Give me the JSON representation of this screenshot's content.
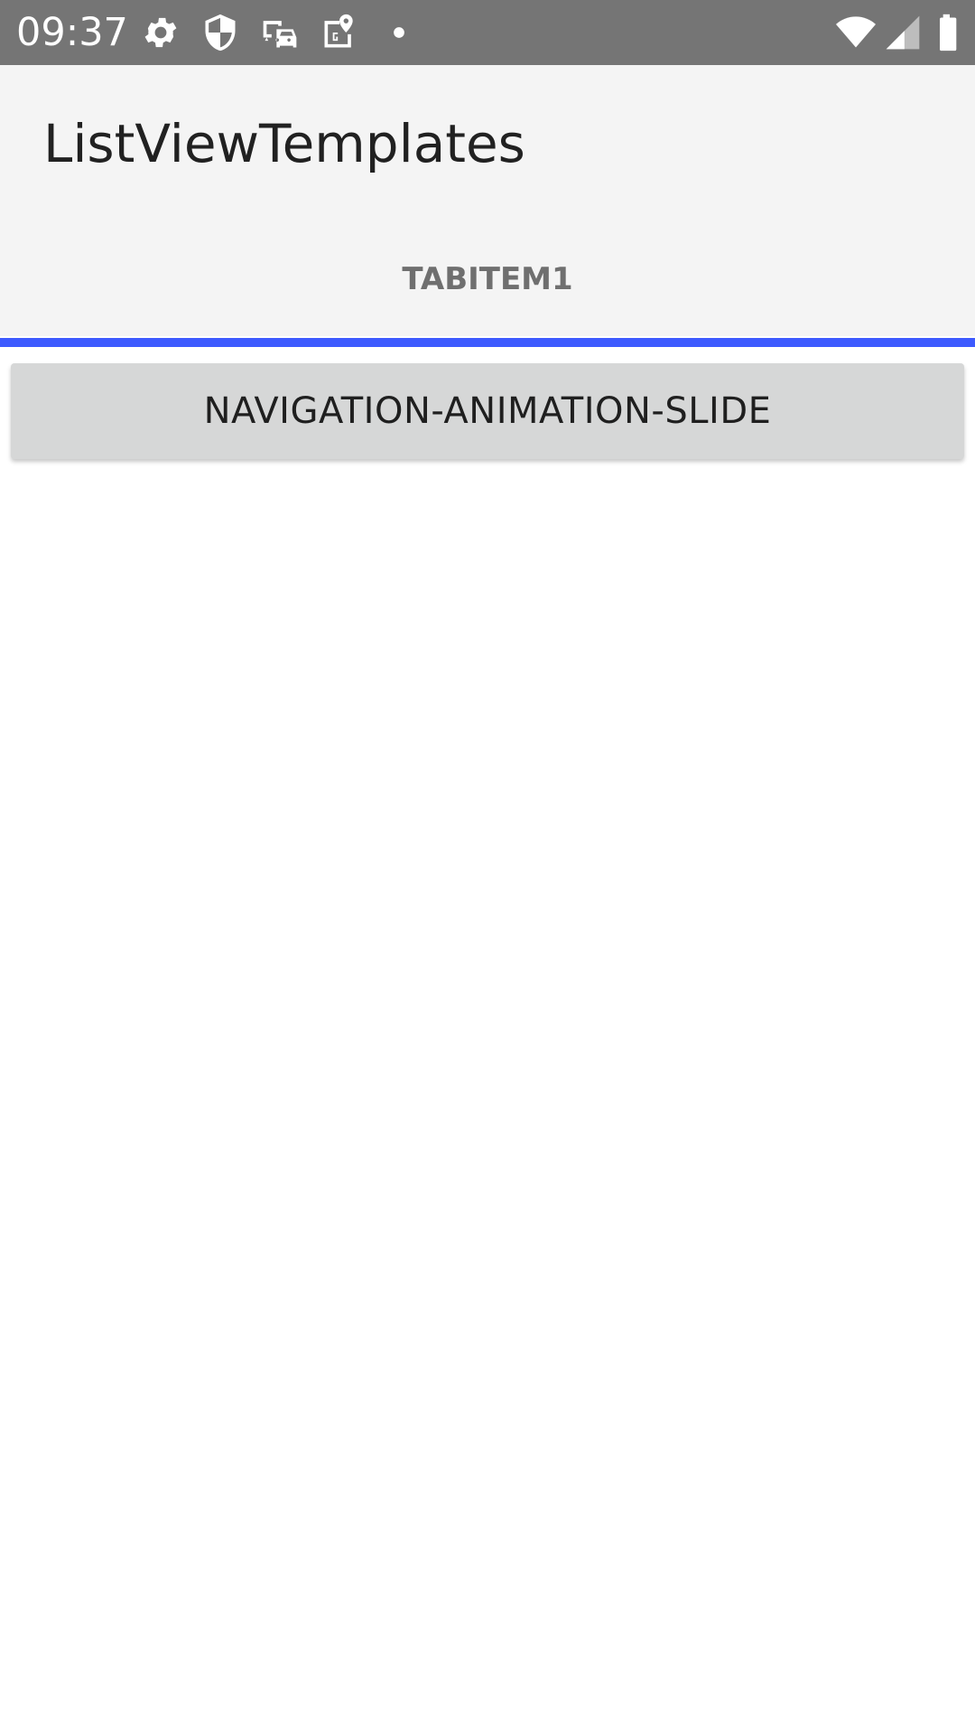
{
  "status_bar": {
    "time": "09:37",
    "background": "#757575",
    "left_icons": [
      "settings-icon",
      "shield-icon",
      "driving-mode-icon",
      "maps-icon",
      "dot-icon"
    ],
    "right_icons": [
      "wifi-icon",
      "cell-signal-icon",
      "battery-icon"
    ]
  },
  "app_bar": {
    "title": "ListViewTemplates",
    "background": "#f4f4f4"
  },
  "tabs": [
    {
      "label": "TABITEM1",
      "selected": true
    }
  ],
  "accent_color": "#3d5afe",
  "content": {
    "button_label": "NAVIGATION-ANIMATION-SLIDE"
  }
}
